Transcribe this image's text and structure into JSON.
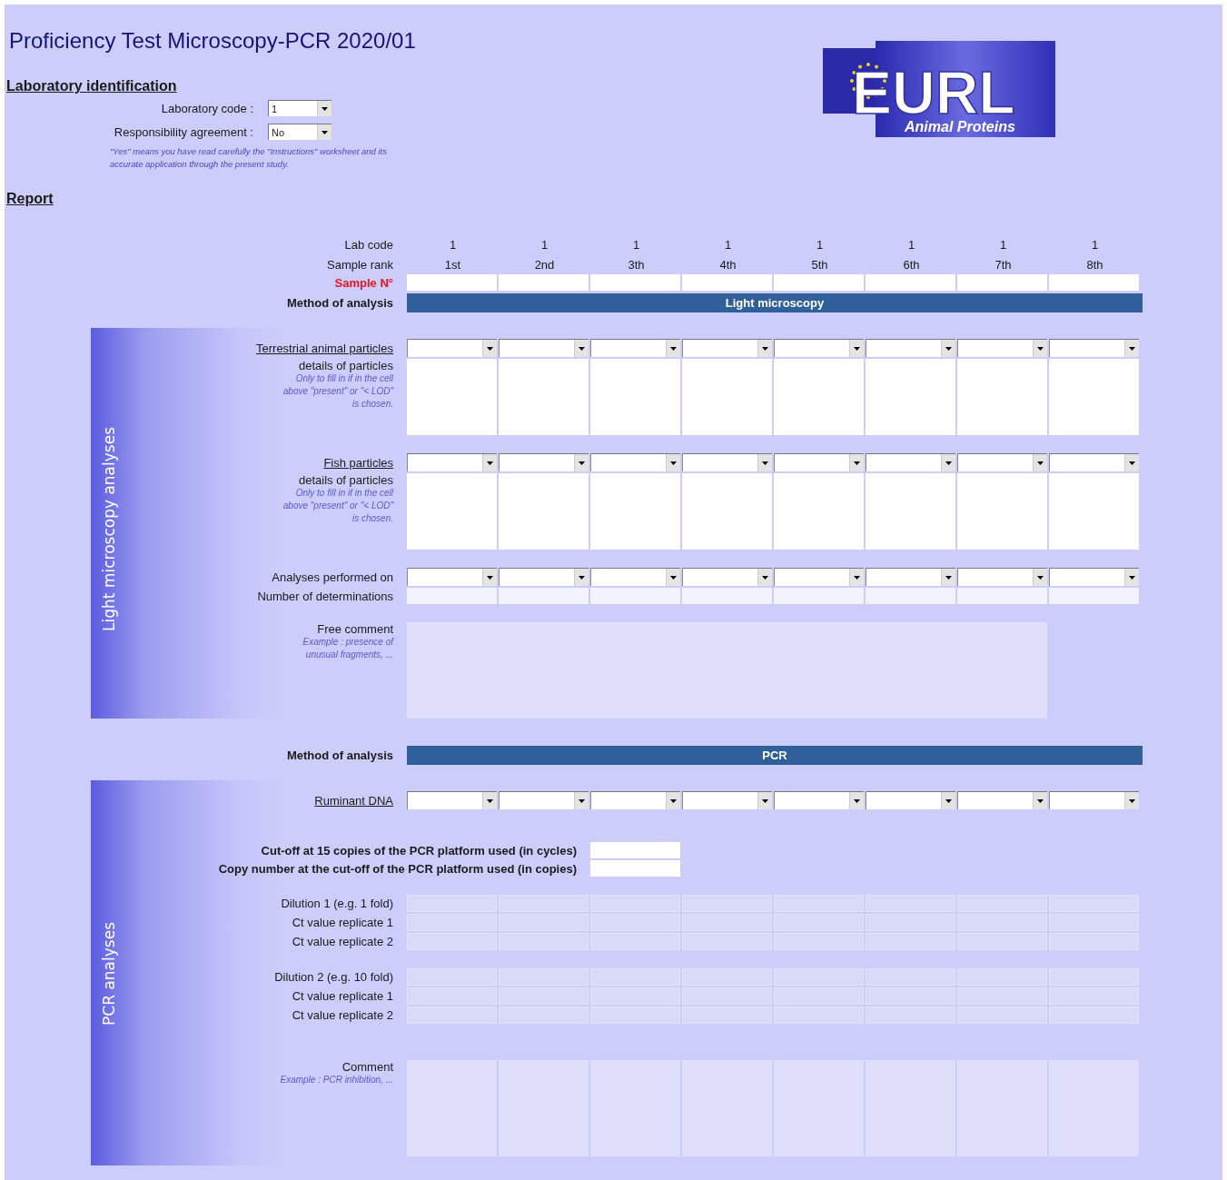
{
  "title": "Proficiency Test Microscopy-PCR 2020/01",
  "logo": {
    "name": "EURL",
    "subtitle": "Animal Proteins"
  },
  "lab_identification": {
    "heading": "Laboratory identification",
    "fields": [
      {
        "label": "Laboratory code :",
        "value": "1"
      },
      {
        "label": "Responsibility agreement :",
        "value": "No"
      }
    ],
    "note": "\"Yes\" means you have read carefully the \"Instructions\" worksheet and its accurate application through the present study."
  },
  "report": {
    "heading": "Report",
    "lab_code": {
      "label": "Lab code",
      "values": [
        "1",
        "1",
        "1",
        "1",
        "1",
        "1",
        "1",
        "1"
      ]
    },
    "sample_rank": {
      "label": "Sample rank",
      "values": [
        "1st",
        "2nd",
        "3th",
        "4th",
        "5th",
        "6th",
        "7th",
        "8th"
      ]
    },
    "sample_number": {
      "label": "Sample N°"
    },
    "sections": [
      {
        "method": {
          "label": "Method of analysis",
          "value": "Light microscopy"
        },
        "title": "Light microscopy analyses",
        "groups": [
          [
            {
              "kind": "dropdown",
              "label": "Terrestrial animal particles",
              "underlined": true
            },
            {
              "kind": "details",
              "label": "details of particles",
              "hint": "Only to fill in if in the cell above \"present\" or \"< LOD\" is chosen."
            }
          ],
          [
            {
              "kind": "dropdown",
              "label": "Fish particles",
              "underlined": true
            },
            {
              "kind": "details",
              "label": "details of particles",
              "hint": "Only to fill in if in the cell above \"present\" or \"< LOD\" is chosen."
            }
          ],
          [
            {
              "kind": "dropdown",
              "label": "Analyses performed on",
              "underlined": false
            },
            {
              "kind": "input",
              "label": "Number of determinations"
            }
          ],
          [
            {
              "kind": "wide_comment",
              "label": "Free comment",
              "hint": "Example : presence of unusual fragments, ..."
            }
          ]
        ]
      },
      {
        "method": {
          "label": "Method of analysis",
          "value": "PCR"
        },
        "title": "PCR analyses",
        "groups": [
          [
            {
              "kind": "dropdown",
              "label": "Ruminant DNA",
              "underlined": true
            }
          ],
          [
            {
              "kind": "single_input",
              "label": "Cut-off at 15 copies of the PCR platform used (in cycles)"
            },
            {
              "kind": "single_input",
              "label": "Copy number at the cut-off of the PCR platform used (in copies)"
            }
          ],
          [
            {
              "kind": "grid",
              "label": "Dilution 1 (e.g. 1 fold)"
            },
            {
              "kind": "grid",
              "label": "Ct value replicate 1"
            },
            {
              "kind": "grid",
              "label": "Ct value replicate 2"
            }
          ],
          [
            {
              "kind": "grid",
              "label": "Dilution 2 (e.g. 10 fold)"
            },
            {
              "kind": "grid",
              "label": "Ct value replicate 1"
            },
            {
              "kind": "grid",
              "label": "Ct value replicate 2"
            }
          ],
          [
            {
              "kind": "comment",
              "label": "Comment",
              "hint": "Example : PCR inhibition, ..."
            }
          ]
        ]
      }
    ]
  }
}
